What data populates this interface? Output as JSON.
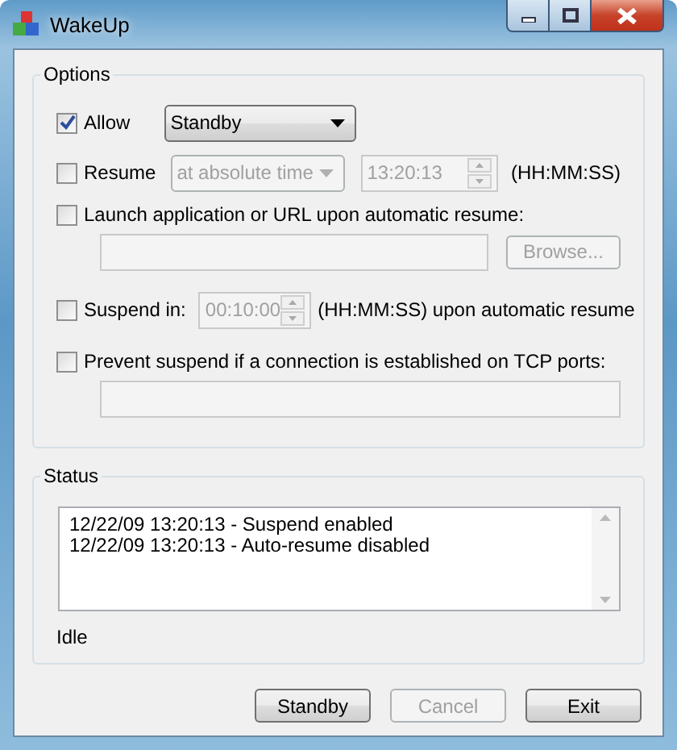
{
  "window": {
    "title": "WakeUp"
  },
  "options": {
    "title": "Options",
    "allow": {
      "label": "Allow",
      "checked": true,
      "mode": "Standby",
      "disabled": false
    },
    "resume": {
      "label": "Resume",
      "checked": false,
      "mode": "at absolute time",
      "time": "13:20:13",
      "format": "(HH:MM:SS)",
      "disabled": true
    },
    "launch": {
      "label": "Launch application or URL upon automatic resume:",
      "checked": false,
      "browse": "Browse...",
      "disabled": true
    },
    "suspend": {
      "label": "Suspend in:",
      "checked": false,
      "time": "00:10:00",
      "suffix": "(HH:MM:SS) upon automatic resume",
      "disabled": true
    },
    "prevent": {
      "label": "Prevent suspend if a connection is established on TCP ports:",
      "checked": false,
      "disabled": true
    }
  },
  "status": {
    "title": "Status",
    "log": [
      "12/22/09 13:20:13 - Suspend enabled",
      "12/22/09 13:20:13 - Auto-resume disabled"
    ],
    "state": "Idle"
  },
  "buttons": [
    {
      "label": "Standby",
      "disabled": false
    },
    {
      "label": "Cancel",
      "disabled": true
    },
    {
      "label": "Exit",
      "disabled": false
    }
  ]
}
